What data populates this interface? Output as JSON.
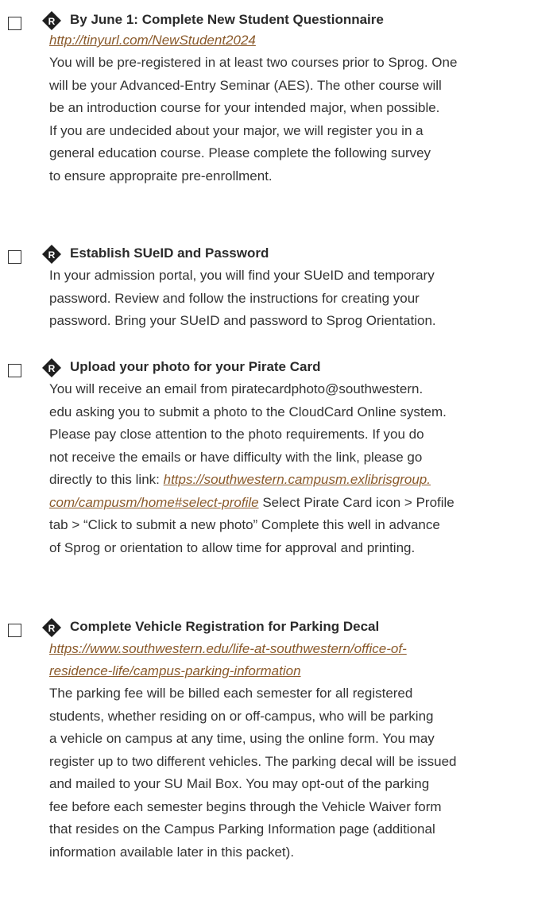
{
  "items": [
    {
      "title": "By June 1: Complete New Student Questionnaire",
      "link": "http://tinyurl.com/NewStudent2024",
      "lines": [
        "You will be pre-registered in at least two courses prior to Sprog. One",
        "will be your Advanced-Entry Seminar (AES). The other course will",
        "be an introduction course for your intended major, when possible.",
        "If you are undecided about your major, we will register you in a",
        "general education course. Please complete the following survey",
        "to ensure appropraite pre-enrollment."
      ]
    },
    {
      "title": "Establish SUeID and Password",
      "lines": [
        "In your admission portal, you will find your SUeID and temporary",
        "password. Review and follow the instructions for creating your",
        "password. Bring your SUeID and password to Sprog Orientation."
      ]
    },
    {
      "title": "Upload your photo for your Pirate Card",
      "lines_before": [
        "You will receive an email from piratecardphoto@southwestern.",
        "edu asking you to submit a photo to the CloudCard Online system.",
        "Please pay close attention to the photo requirements. If you do",
        "not receive the emails or have difficulty with the link, please go"
      ],
      "link_line_prefix": "directly to this link: ",
      "link_part1": "https://southwestern.campusm.exlibrisgroup.",
      "link_part2": "com/campusm/home#select-profile",
      "link_line_suffix": " Select Pirate Card icon > Profile",
      "lines_after": [
        "tab > “Click to submit a new photo” Complete this well in advance",
        "of Sprog or orientation to allow time for approval and printing."
      ]
    },
    {
      "title": "Complete Vehicle Registration for Parking Decal",
      "link_lines": [
        "https://www.southwestern.edu/life-at-southwestern/office-of-",
        "residence-life/campus-parking-information"
      ],
      "lines": [
        "The parking fee will be billed each semester for all registered",
        "students, whether residing on or off-campus, who will be parking",
        "a vehicle on campus at any time, using the online form. You may",
        "register up to two different vehicles. The parking decal will be issued",
        "and mailed to your SU Mail Box. You may opt-out of the parking",
        "fee before each semester begins through the Vehicle Waiver form",
        "that resides on the Campus Parking Information page (additional",
        "information available later in this packet)."
      ]
    }
  ]
}
